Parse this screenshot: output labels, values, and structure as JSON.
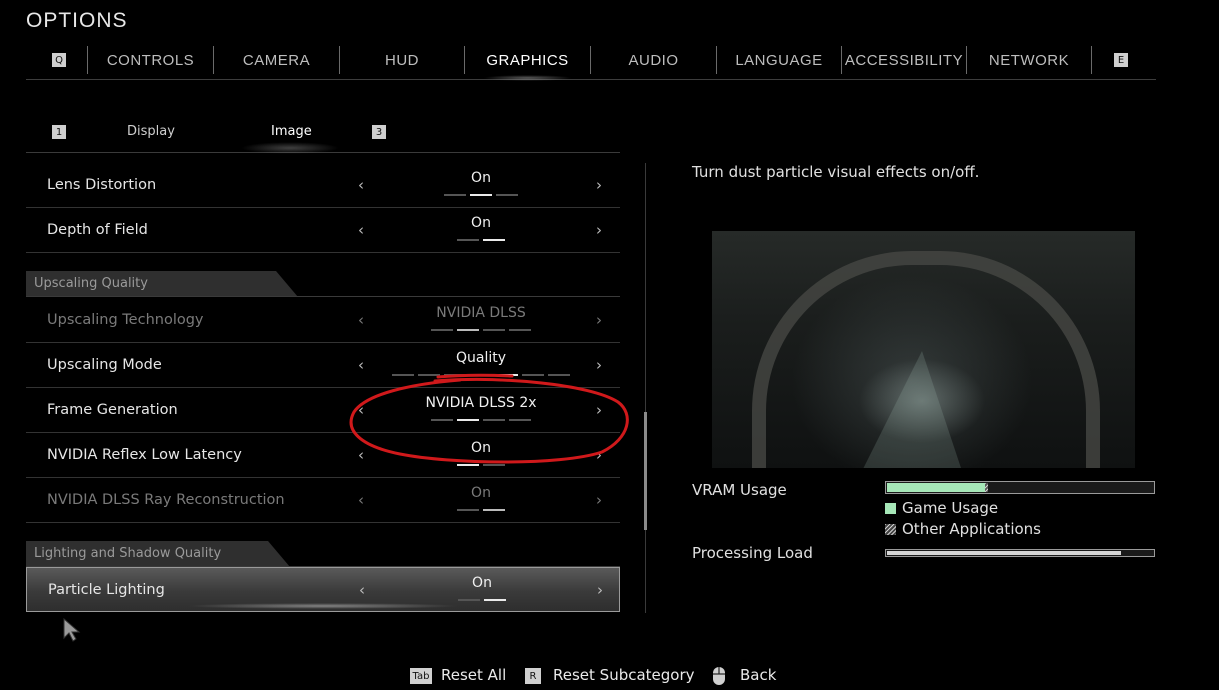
{
  "title": "OPTIONS",
  "tabs": {
    "prev_key": "Q",
    "next_key": "E",
    "items": [
      {
        "label": "CONTROLS"
      },
      {
        "label": "CAMERA"
      },
      {
        "label": "HUD"
      },
      {
        "label": "GRAPHICS",
        "active": true
      },
      {
        "label": "AUDIO"
      },
      {
        "label": "LANGUAGE"
      },
      {
        "label": "ACCESSIBILITY"
      },
      {
        "label": "NETWORK"
      }
    ]
  },
  "subtabs": {
    "prev_key": "1",
    "next_key": "3",
    "items": [
      {
        "label": "Display"
      },
      {
        "label": "Image",
        "active": true
      }
    ]
  },
  "settings": [
    {
      "label": "Lens Distortion",
      "value": "On",
      "options": 3,
      "selected_index": 1
    },
    {
      "label": "Depth of Field",
      "value": "On",
      "options": 2,
      "selected_index": 1
    }
  ],
  "section_upscaling": {
    "title": "Upscaling Quality",
    "rows": [
      {
        "label": "Upscaling Technology",
        "value": "NVIDIA DLSS",
        "options": 4,
        "selected_index": 1,
        "disabled": true
      },
      {
        "label": "Upscaling Mode",
        "value": "Quality",
        "options": 7,
        "selected_index": 4
      },
      {
        "label": "Frame Generation",
        "value": "NVIDIA DLSS 2x",
        "options": 4,
        "selected_index": 1
      },
      {
        "label": "NVIDIA Reflex Low Latency",
        "value": "On",
        "options": 2,
        "selected_index": 0
      },
      {
        "label": "NVIDIA DLSS Ray Reconstruction",
        "value": "On",
        "options": 2,
        "selected_index": 1,
        "disabled": true
      }
    ]
  },
  "section_lighting": {
    "title": "Lighting and Shadow Quality",
    "rows": [
      {
        "label": "Particle Lighting",
        "value": "On",
        "options": 2,
        "selected_index": 1,
        "selected": true
      }
    ]
  },
  "description": "Turn dust particle visual effects on/off.",
  "vram": {
    "label": "VRAM Usage",
    "game_usage_fraction": 0.37,
    "other_fraction": 0.01,
    "legend_game": "Game Usage",
    "legend_other": "Other Applications",
    "game_color": "#a6e7b8"
  },
  "processing": {
    "label": "Processing Load",
    "fraction": 0.88
  },
  "footer": {
    "reset_all_key": "Tab",
    "reset_all_label": "Reset All",
    "reset_sub_key": "R",
    "reset_sub_label": "Reset Subcategory",
    "back_label": "Back"
  },
  "annotation_color": "#d0191b"
}
